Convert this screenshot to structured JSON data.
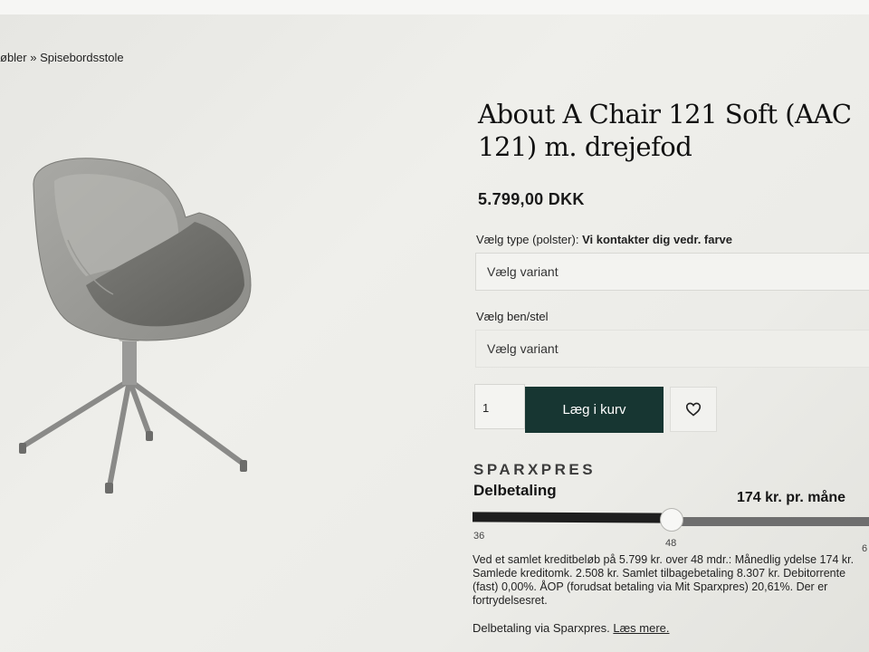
{
  "breadcrumb": {
    "text": "øbler » Spisebordsstole"
  },
  "product": {
    "title": "About A Chair 121 Soft (AAC 121) m. drejefod",
    "price": "5.799,00  DKK"
  },
  "options": {
    "type_label": "Vælg type (polster):",
    "type_note": "Vi kontakter dig vedr. farve",
    "type_placeholder": "Vælg variant",
    "base_label": "Vælg ben/stel",
    "base_placeholder": "Vælg variant"
  },
  "cart": {
    "quantity": "1",
    "add_label": "Læg i kurv",
    "favorite_icon": "heart-icon"
  },
  "sparxpres": {
    "brand": "SPARXPRES",
    "heading": "Delbetaling",
    "monthly": "174 kr. pr. måne",
    "slider": {
      "min": "36",
      "value": "48",
      "max": "6",
      "value_fraction": 0.42
    },
    "fine_print": "Ved et samlet kreditbeløb på 5.799 kr. over 48 mdr.: Månedlig ydelse 174 kr. Samlede kreditomk. 2.508 kr. Samlet tilbagebetaling 8.307 kr. Debitorrente (fast) 0,00%. ÅOP (forudsat betaling via Mit Sparxpres) 20,61%. Der er fortrydelsesret.",
    "footer_text": "Delbetaling via Sparxpres.",
    "footer_link": "Læs mere."
  },
  "colors": {
    "cart_button": "#173632",
    "track_filled": "#1e1e1e",
    "track_empty": "#6e6e6e"
  }
}
